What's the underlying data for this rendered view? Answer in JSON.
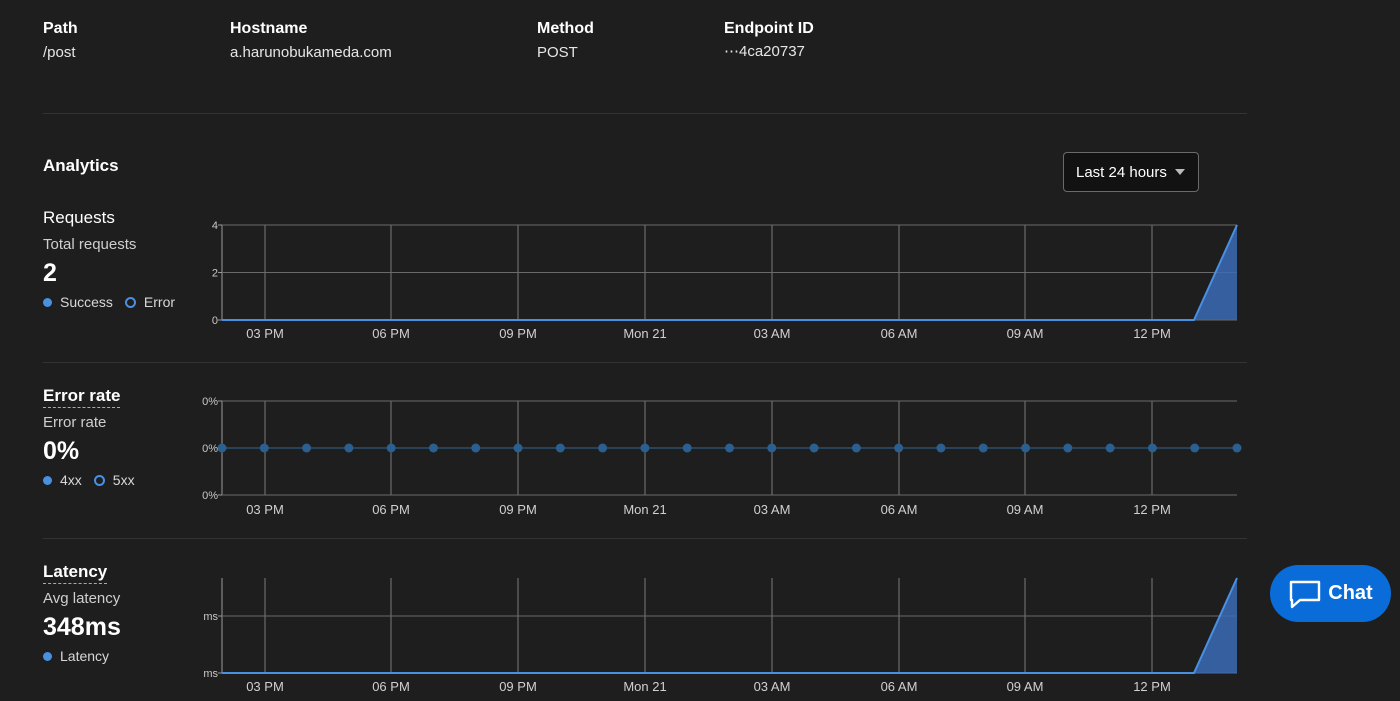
{
  "details": {
    "path": {
      "label": "Path",
      "value": "/post"
    },
    "hostname": {
      "label": "Hostname",
      "value": "a.harunobukameda.com"
    },
    "method": {
      "label": "Method",
      "value": "POST"
    },
    "endpoint": {
      "label": "Endpoint ID",
      "value": "⋯4ca20737"
    }
  },
  "analytics": {
    "title": "Analytics",
    "time_range": "Last 24 hours"
  },
  "requests": {
    "title": "Requests",
    "subtitle": "Total requests",
    "value": "2",
    "legend": [
      "Success",
      "Error"
    ]
  },
  "error_rate": {
    "title": "Error rate",
    "subtitle": "Error rate",
    "value": "0%",
    "legend": [
      "4xx",
      "5xx"
    ]
  },
  "latency": {
    "title": "Latency",
    "subtitle": "Avg latency",
    "value": "348ms",
    "legend": [
      "Latency"
    ]
  },
  "chat": {
    "label": "Chat"
  },
  "colors": {
    "accent": "#4a90e2",
    "area": "#3a6bb5",
    "grid": "#666666",
    "chat": "#0a6cd8",
    "error_series": "#2b5f8f"
  },
  "chart_data": [
    {
      "type": "area",
      "name": "requests",
      "x": [
        "03 PM",
        "06 PM",
        "09 PM",
        "Mon 21",
        "03 AM",
        "06 AM",
        "09 AM",
        "12 PM"
      ],
      "y_ticks": [
        "4",
        "2",
        "0"
      ],
      "ylim": [
        0,
        4
      ],
      "series": [
        {
          "name": "Success",
          "values": [
            0,
            0,
            0,
            0,
            0,
            0,
            0,
            0,
            0,
            4
          ]
        }
      ],
      "grid": true
    },
    {
      "type": "line",
      "name": "error_rate",
      "x": [
        "03 PM",
        "06 PM",
        "09 PM",
        "Mon 21",
        "03 AM",
        "06 AM",
        "09 AM",
        "12 PM"
      ],
      "y_ticks": [
        "0%",
        "0%",
        "0%"
      ],
      "series": [
        {
          "name": "4xx",
          "values": [
            0,
            0,
            0,
            0,
            0,
            0,
            0,
            0,
            0,
            0,
            0,
            0,
            0,
            0,
            0,
            0,
            0,
            0,
            0,
            0,
            0,
            0,
            0,
            0,
            0
          ]
        }
      ],
      "grid": true
    },
    {
      "type": "area",
      "name": "latency",
      "x": [
        "03 PM",
        "06 PM",
        "09 PM",
        "Mon 21",
        "03 AM",
        "06 AM",
        "09 AM",
        "12 PM"
      ],
      "y_ticks": [
        "ms",
        "ms"
      ],
      "series": [
        {
          "name": "Latency",
          "values": [
            0,
            0,
            0,
            0,
            0,
            0,
            0,
            0,
            0,
            1
          ]
        }
      ],
      "grid": true
    }
  ]
}
